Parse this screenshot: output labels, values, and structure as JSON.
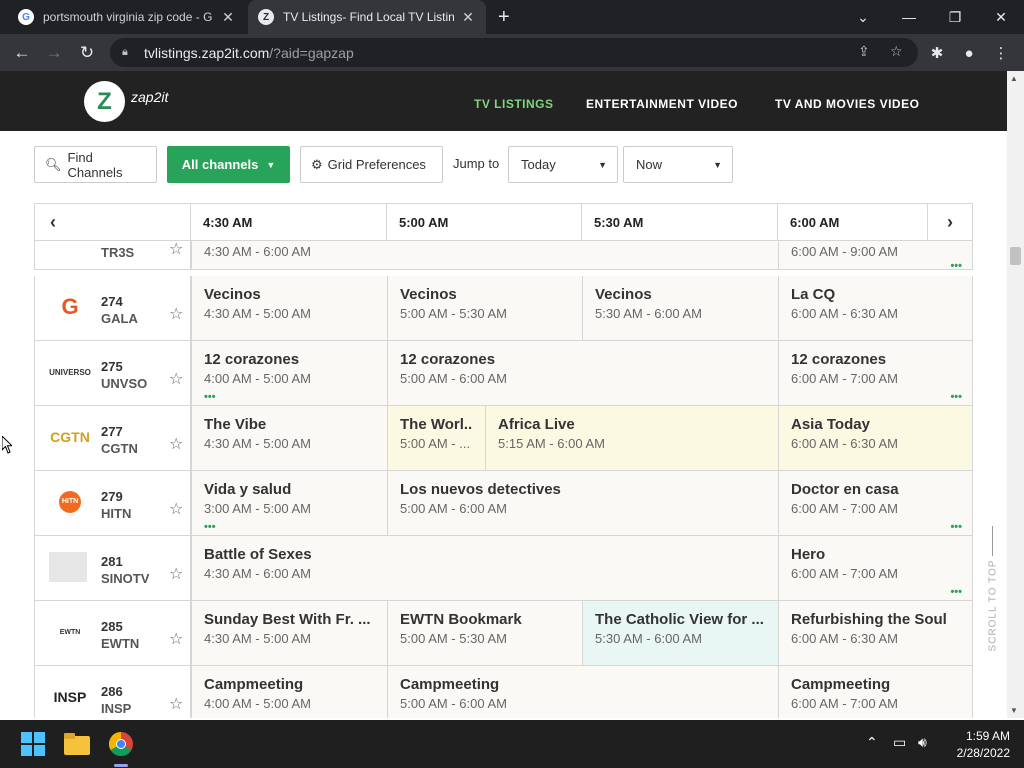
{
  "browser": {
    "tabs": [
      {
        "title": "portsmouth virginia zip code - G",
        "favicon": "G"
      },
      {
        "title": "TV Listings- Find Local TV Listing",
        "favicon": "Z"
      }
    ],
    "new_tab": "+",
    "url_host": "tvlistings.zap2it.com",
    "url_path": "/?aid=gapzap"
  },
  "site": {
    "logo_letter": "Z",
    "logo_text": "zap2it",
    "nav": [
      "TV LISTINGS",
      "ENTERTAINMENT VIDEO",
      "TV AND MOVIES VIDEO"
    ]
  },
  "controls": {
    "find_channels": "Find Channels",
    "all_channels": "All channels",
    "grid_prefs": "Grid Preferences",
    "jump_to": "Jump to",
    "day": "Today",
    "time": "Now"
  },
  "grid": {
    "times": [
      "4:30 AM",
      "5:00 AM",
      "5:30 AM",
      "6:00 AM"
    ],
    "rows": [
      {
        "num": "",
        "name": "TR3S",
        "logo": "tr3s",
        "programs": [
          {
            "title": "",
            "time": "4:30 AM - 6:00 AM"
          },
          {
            "title": "",
            "time": "6:00 AM - 9:00 AM"
          }
        ]
      },
      {
        "num": "274",
        "name": "GALA",
        "logo": "G",
        "programs": [
          {
            "title": "Vecinos",
            "time": "4:30 AM - 5:00 AM"
          },
          {
            "title": "Vecinos",
            "time": "5:00 AM - 5:30 AM"
          },
          {
            "title": "Vecinos",
            "time": "5:30 AM - 6:00 AM"
          },
          {
            "title": "La CQ",
            "time": "6:00 AM - 6:30 AM"
          }
        ]
      },
      {
        "num": "275",
        "name": "UNVSO",
        "logo": "UNIVERSO",
        "programs": [
          {
            "title": "12 corazones",
            "time": "4:00 AM - 5:00 AM"
          },
          {
            "title": "12 corazones",
            "time": "5:00 AM - 6:00 AM"
          },
          {
            "title": "12 corazones",
            "time": "6:00 AM - 7:00 AM"
          }
        ]
      },
      {
        "num": "277",
        "name": "CGTN",
        "logo": "CGTN",
        "programs": [
          {
            "title": "The Vibe",
            "time": "4:30 AM - 5:00 AM"
          },
          {
            "title": "The Worl...",
            "time": "5:00 AM - ..."
          },
          {
            "title": "Africa Live",
            "time": "5:15 AM - 6:00 AM"
          },
          {
            "title": "Asia Today",
            "time": "6:00 AM - 6:30 AM"
          }
        ]
      },
      {
        "num": "279",
        "name": "HITN",
        "logo": "HITN",
        "programs": [
          {
            "title": "Vida y salud",
            "time": "3:00 AM - 5:00 AM"
          },
          {
            "title": "Los nuevos detectives",
            "time": "5:00 AM - 6:00 AM"
          },
          {
            "title": "Doctor en casa",
            "time": "6:00 AM - 7:00 AM"
          }
        ]
      },
      {
        "num": "281",
        "name": "SINOTV",
        "logo": "",
        "programs": [
          {
            "title": "Battle of Sexes",
            "time": "4:30 AM - 6:00 AM"
          },
          {
            "title": "Hero",
            "time": "6:00 AM - 7:00 AM"
          }
        ]
      },
      {
        "num": "285",
        "name": "EWTN",
        "logo": "EWTN",
        "programs": [
          {
            "title": "Sunday Best With Fr. ...",
            "time": "4:30 AM - 5:00 AM"
          },
          {
            "title": "EWTN Bookmark",
            "time": "5:00 AM - 5:30 AM"
          },
          {
            "title": "The Catholic View for ...",
            "time": "5:30 AM - 6:00 AM"
          },
          {
            "title": "Refurbishing the Soul",
            "time": "6:00 AM - 6:30 AM"
          }
        ]
      },
      {
        "num": "286",
        "name": "INSP",
        "logo": "INSP",
        "programs": [
          {
            "title": "Campmeeting",
            "time": "4:00 AM - 5:00 AM"
          },
          {
            "title": "Campmeeting",
            "time": "5:00 AM - 6:00 AM"
          },
          {
            "title": "Campmeeting",
            "time": "6:00 AM - 7:00 AM"
          }
        ]
      }
    ],
    "more_dots": "•••"
  },
  "scroll_to_top": "SCROLL TO TOP",
  "taskbar": {
    "time": "1:59 AM",
    "date": "2/28/2022"
  },
  "colors": {
    "accent_green": "#27a35a",
    "nav_active": "#7fd67f",
    "header_bg": "#222222"
  }
}
